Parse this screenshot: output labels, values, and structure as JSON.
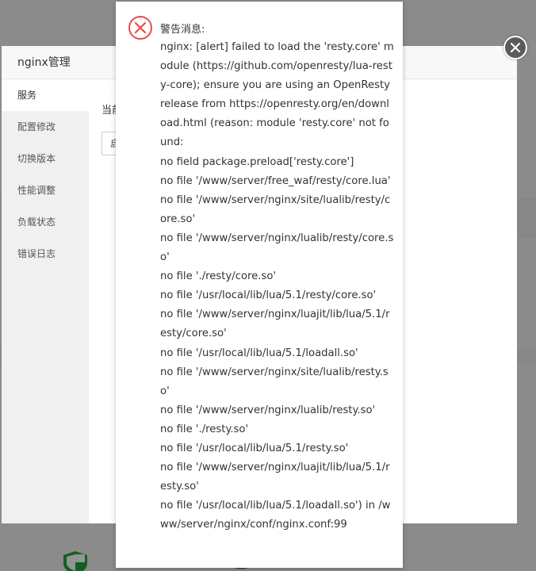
{
  "dialog": {
    "title": "nginx管理",
    "sidebar": [
      {
        "label": "服务",
        "active": true
      },
      {
        "label": "配置修改",
        "active": false
      },
      {
        "label": "切换版本",
        "active": false
      },
      {
        "label": "性能调整",
        "active": false
      },
      {
        "label": "负载状态",
        "active": false
      },
      {
        "label": "错误日志",
        "active": false
      }
    ],
    "status_label": "当前",
    "start_button": "启"
  },
  "alert": {
    "title": "警告消息:",
    "message": "nginx: [alert] failed to load the 'resty.core' module (https://github.com/openresty/lua-resty-core); ensure you are using an OpenResty release from https://openresty.org/en/download.html (reason: module 'resty.core' not found:\nno field package.preload['resty.core']\nno file '/www/server/free_waf/resty/core.lua'\nno file '/www/server/nginx/site/lualib/resty/core.so'\nno file '/www/server/nginx/lualib/resty/core.so'\nno file './resty/core.so'\nno file '/usr/local/lib/lua/5.1/resty/core.so'\nno file '/www/server/nginx/luajit/lib/lua/5.1/resty/core.so'\nno file '/usr/local/lib/lua/5.1/loadall.so'\nno file '/www/server/nginx/site/lualib/resty.so'\nno file '/www/server/nginx/lualib/resty.so'\nno file './resty.so'\nno file '/usr/local/lib/lua/5.1/resty.so'\nno file '/www/server/nginx/luajit/lib/lua/5.1/resty.so'\nno file '/usr/local/lib/lua/5.1/loadall.so') in /www/server/nginx/conf/nginx.conf:99",
    "icon": "error-circle-icon",
    "icon_color": "#e94b4b"
  },
  "colors": {
    "overlay": "rgba(0,0,0,0.42)",
    "close_button": "#5b5b5b"
  }
}
